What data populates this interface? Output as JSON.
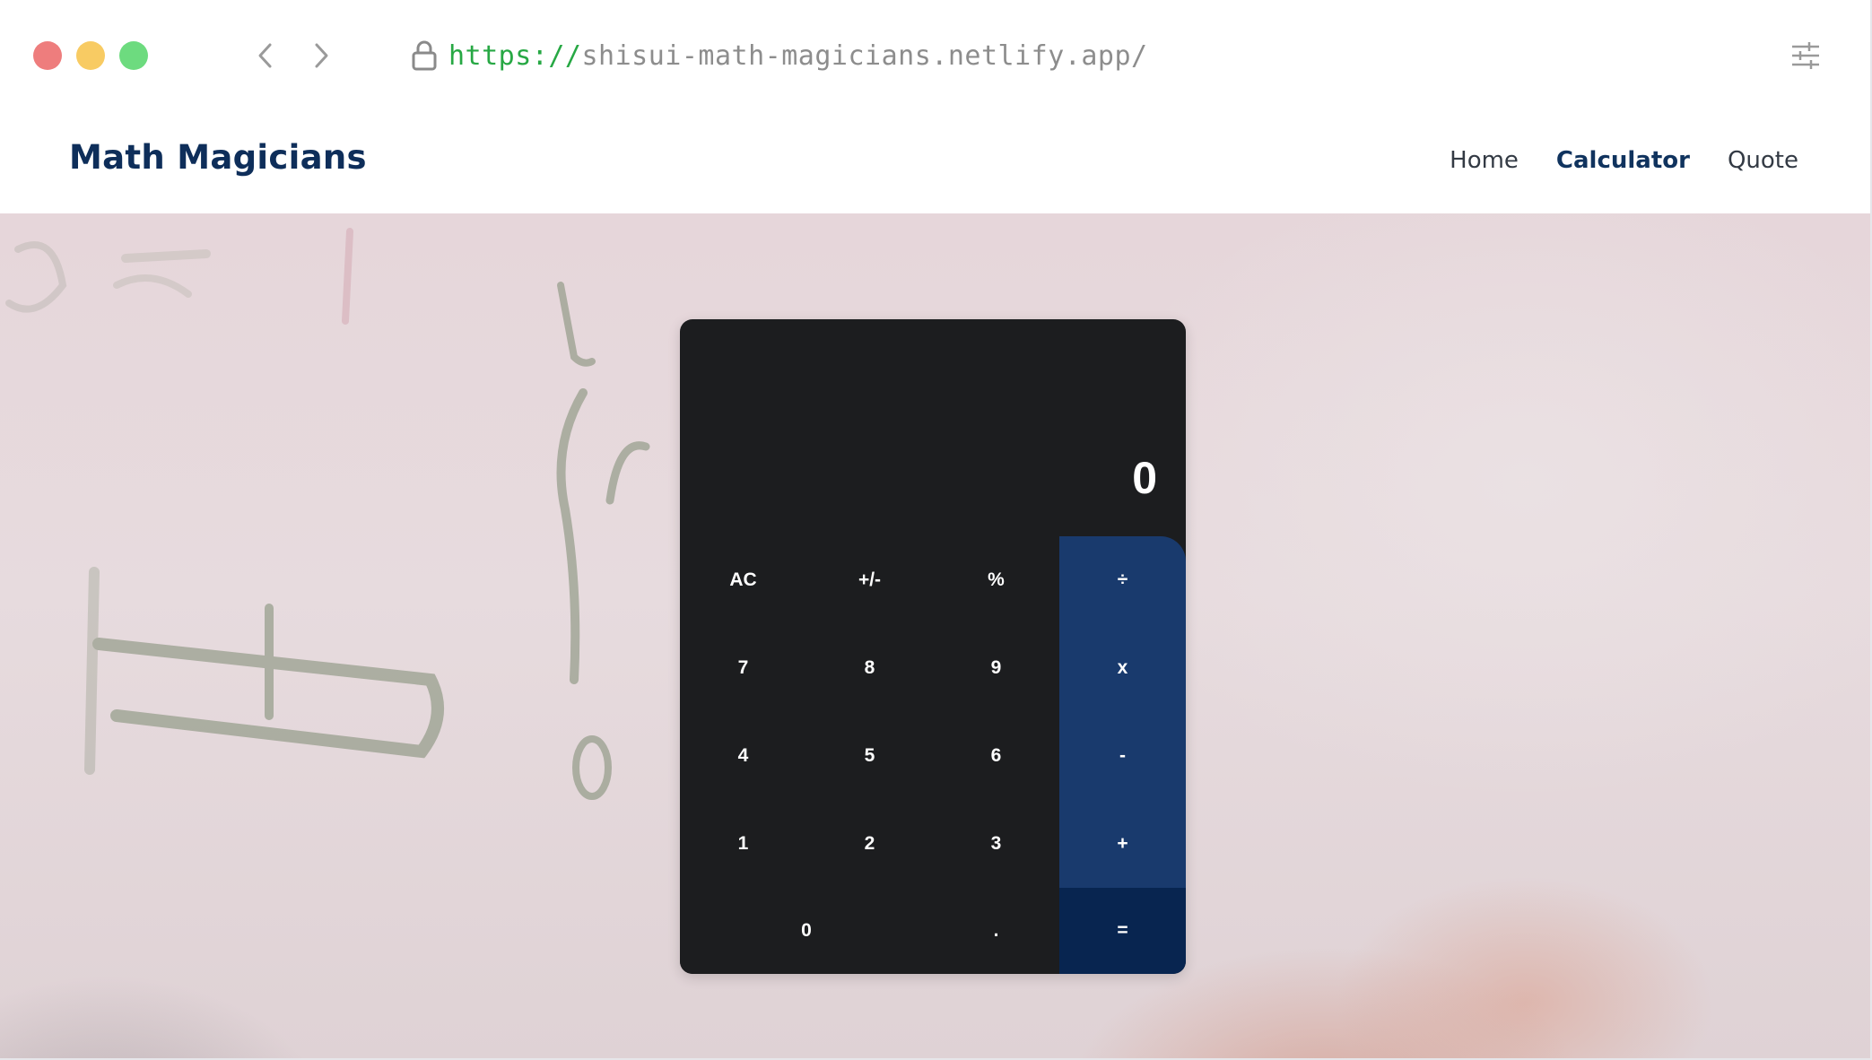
{
  "browser": {
    "url_scheme": "https://",
    "url_host": "shisui-math-magicians.netlify.app/"
  },
  "site": {
    "logo": "Math Magicians",
    "nav": [
      "Home",
      "Calculator",
      "Quote"
    ],
    "active_nav": "Calculator"
  },
  "calculator": {
    "display": "0",
    "rows": [
      [
        "AC",
        "+/-",
        "%",
        "÷"
      ],
      [
        "7",
        "8",
        "9",
        "x"
      ],
      [
        "4",
        "5",
        "6",
        "-"
      ],
      [
        "1",
        "2",
        "3",
        "+"
      ],
      [
        "0",
        ".",
        "="
      ]
    ]
  },
  "colors": {
    "window_dot_red": "#ee7d7d",
    "window_dot_yellow": "#f8cb63",
    "window_dot_green": "#6ddb7f",
    "url_scheme": "#27a844",
    "brand": "#0e2e5a",
    "calc_body": "#1c1d1f",
    "operator_key": "#193a6d",
    "equals_key": "#082550"
  }
}
